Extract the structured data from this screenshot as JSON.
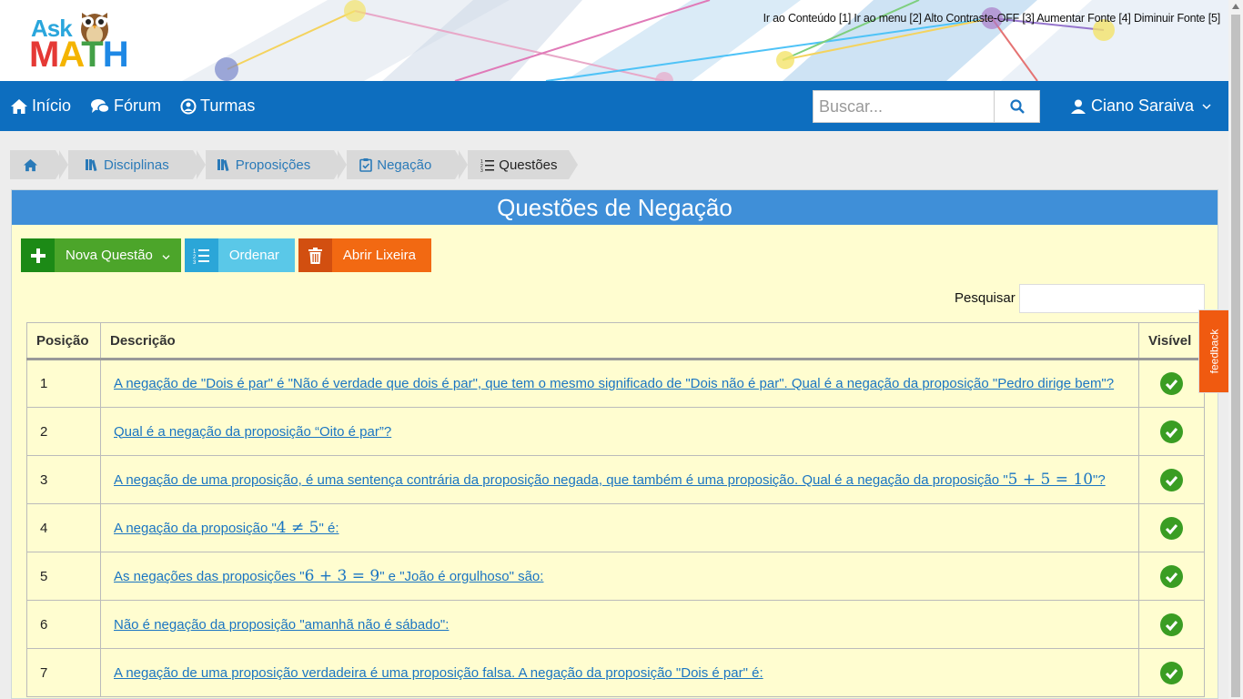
{
  "header": {
    "logo_top": "Ask",
    "logo_bottom": "MATH",
    "accessibility_links": [
      "Ir ao Conteúdo [1]",
      "Ir ao menu [2]",
      "Alto Contraste-OFF [3]",
      "Aumentar Fonte [4]",
      "Diminuir Fonte [5]"
    ]
  },
  "nav": {
    "items": [
      {
        "label": "Início",
        "icon": "home-icon"
      },
      {
        "label": "Fórum",
        "icon": "chat-icon"
      },
      {
        "label": "Turmas",
        "icon": "group-icon"
      }
    ],
    "search_placeholder": "Buscar...",
    "user_name": "Ciano Saraiva"
  },
  "breadcrumb": [
    {
      "label": "",
      "icon": "home-icon"
    },
    {
      "label": "Disciplinas",
      "icon": "books-icon"
    },
    {
      "label": "Proposições",
      "icon": "books-icon"
    },
    {
      "label": "Negação",
      "icon": "clipboard-check-icon"
    },
    {
      "label": "Questões",
      "icon": "list-icon"
    }
  ],
  "panel": {
    "title": "Questões de Negação",
    "buttons": {
      "new_question": "Nova Questão",
      "order": "Ordenar",
      "trash": "Abrir Lixeira"
    },
    "search_label": "Pesquisar"
  },
  "table": {
    "headers": [
      "Posição",
      "Descrição",
      "Visível"
    ],
    "rows": [
      {
        "pos": "1",
        "parts": [
          "A negação de \"Dois é par\" é \"Não é verdade que dois é par\", que tem o mesmo significado de \"Dois não é par\". Qual é a negação da proposição \"Pedro dirige bem\"?"
        ],
        "visible": true
      },
      {
        "pos": "2",
        "parts": [
          "Qual é a negação da proposição “Oito é par”?"
        ],
        "visible": true
      },
      {
        "pos": "3",
        "parts": [
          "A negação de uma proposição, é uma sentença contrária da proposição negada, que também é uma proposição. Qual é a negação da proposição \"",
          "5 + 5 = 10",
          "\"?"
        ],
        "visible": true
      },
      {
        "pos": "4",
        "parts": [
          "A negação da proposição \"",
          "4 ≠ 5",
          "\" é:"
        ],
        "visible": true
      },
      {
        "pos": "5",
        "parts": [
          "As negações das proposições \"",
          "6 + 3 = 9",
          "\" e \"João é orgulhoso\" são:"
        ],
        "visible": true
      },
      {
        "pos": "6",
        "parts": [
          "Não é negação da proposição \"amanhã não é sábado\":"
        ],
        "visible": true
      },
      {
        "pos": "7",
        "parts": [
          "A negação de uma proposição verdadeira é uma proposição falsa. A negação da proposição \"Dois é par\" é:"
        ],
        "visible": true
      }
    ]
  },
  "feedback_label": "feedback",
  "colors": {
    "navbar": "#0d6ebf",
    "panel_title": "#3f8fd8",
    "panel_bg": "#fffdd0",
    "link": "#1a75c2",
    "visible_check": "#3a9d23"
  }
}
